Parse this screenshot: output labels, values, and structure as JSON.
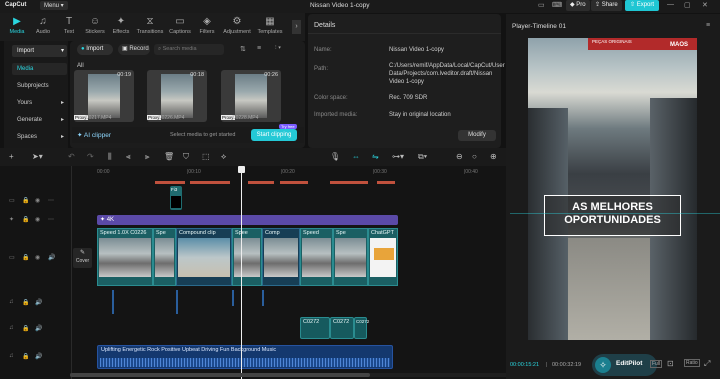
{
  "app": {
    "logo": "CapCut",
    "menu": "Menu",
    "title": "Nissan Video 1-copy",
    "pro": "Pro",
    "share": "Share",
    "export": "Export"
  },
  "tools": [
    {
      "label": "Media",
      "icon": "▶"
    },
    {
      "label": "Audio",
      "icon": "♫"
    },
    {
      "label": "Text",
      "icon": "T"
    },
    {
      "label": "Stickers",
      "icon": "☺"
    },
    {
      "label": "Effects",
      "icon": "✦"
    },
    {
      "label": "Transitions",
      "icon": "⧖"
    },
    {
      "label": "Captions",
      "icon": "▭"
    },
    {
      "label": "Filters",
      "icon": "◈"
    },
    {
      "label": "Adjustment",
      "icon": "⚙"
    },
    {
      "label": "Templates",
      "icon": "▦"
    }
  ],
  "sidebar": [
    {
      "label": "Import"
    },
    {
      "label": "Media"
    },
    {
      "label": "Subprojects"
    },
    {
      "label": "Yours"
    },
    {
      "label": "Generate"
    },
    {
      "label": "Spaces"
    }
  ],
  "media": {
    "import": "Import",
    "record": "Record",
    "search_placeholder": "Search media",
    "filter_all": "All",
    "clipper": "AI clipper",
    "clipper_hint": "Select media to get started",
    "start": "Start clipping",
    "try_free": "Try free",
    "items": [
      {
        "name": "C0217.MP4",
        "duration": "00:19",
        "tag": "Proxy"
      },
      {
        "name": "C0226.MP4",
        "duration": "00:18",
        "tag": "Proxy"
      },
      {
        "name": "C0228.MP4",
        "duration": "00:26",
        "tag": "Proxy"
      }
    ]
  },
  "details": {
    "title": "Details",
    "name_k": "Name:",
    "name_v": "Nissan Video 1-copy",
    "path_k": "Path:",
    "path_v": "C:/Users/remif/AppData/Local/CapCut/User Data/Projects/com.lveditor.draft/Nissan Video 1-copy",
    "color_k": "Color space:",
    "color_v": "Rec. 709 SDR",
    "imported_k": "Imported media:",
    "imported_v": "Stay in original location",
    "modify": "Modify"
  },
  "player": {
    "title": "Player-Timeline 01",
    "overlay_line1": "AS MELHORES",
    "overlay_line2": "OPORTUNIDADES",
    "sign_top": "PEÇAS ORIGINAIS",
    "sign_brand": "MAOS",
    "current": "00:00:15:21",
    "total": "00:00:32:19",
    "editpilot": "EditPilot",
    "full": "Full",
    "ratio": "Ratio"
  },
  "timeline": {
    "ticks": [
      "00:00",
      "|00:10",
      "|00:20",
      "|00:30",
      "|00:40"
    ],
    "fx_label": "4K",
    "cover": "Cover",
    "text_clip": "Fi3",
    "clips": [
      {
        "label": "Speed 1.0X  C0226"
      },
      {
        "label": "Spe"
      },
      {
        "label": "Compound clip"
      },
      {
        "label": "Spee"
      },
      {
        "label": "Comp"
      },
      {
        "label": "Speed"
      },
      {
        "label": "Spe"
      },
      {
        "label": "ChatGPT"
      }
    ],
    "small_clips": [
      "C0272",
      "C0272",
      "C0272"
    ],
    "audio": "Uplifting Energetic Rock Positive Upbeat Driving Fun Background Music"
  }
}
